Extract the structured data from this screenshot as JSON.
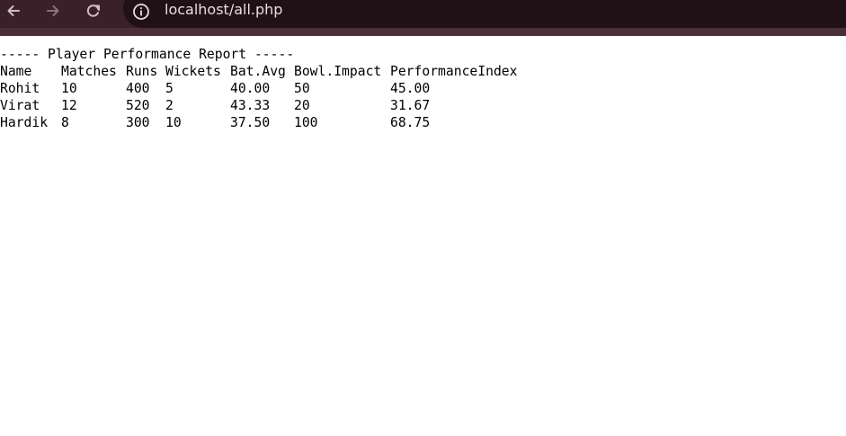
{
  "browser": {
    "url": "localhost/all.php",
    "icons": {
      "back": "back-arrow-icon",
      "forward": "forward-arrow-icon",
      "reload": "reload-icon",
      "site_info": "info-icon"
    },
    "colors": {
      "toolbar": "#3a2129",
      "omnibox": "#1f1115",
      "url_text": "#e8dde0"
    }
  },
  "report": {
    "title": "----- Player Performance Report -----",
    "headers": [
      "Name",
      "Matches",
      "Runs",
      "Wickets",
      "Bat.Avg",
      "Bowl.Impact",
      "PerformanceIndex"
    ],
    "rows": [
      [
        "Rohit",
        "10",
        "400",
        "5",
        "40.00",
        "50",
        "45.00"
      ],
      [
        "Virat",
        "12",
        "520",
        "2",
        "43.33",
        "20",
        "31.67"
      ],
      [
        "Hardik",
        "8",
        "300",
        "10",
        "37.50",
        "100",
        "68.75"
      ]
    ]
  }
}
